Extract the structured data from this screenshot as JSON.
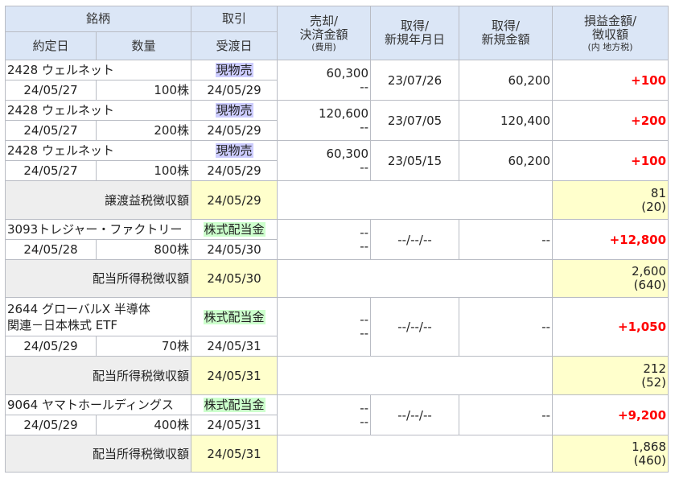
{
  "header": {
    "row1": [
      "銘柄",
      "取引",
      "売却/\n決済金額",
      "取得/\n新規年月日",
      "取得/\n新規金額",
      "損益金額/\n徴収額"
    ],
    "row2": [
      "約定日",
      "数量",
      "受渡日"
    ],
    "sell_sub": "(費用)",
    "pl_sub": "(内 地方税)"
  },
  "trades": [
    {
      "name": "2428 ウェルネット",
      "type": "現物売",
      "tdate": "24/05/27",
      "qty": "100株",
      "ddate": "24/05/29",
      "amount": "60,300",
      "cost": "--",
      "acq_date": "23/07/26",
      "acq_amount": "60,200",
      "pl": "+100"
    },
    {
      "name": "2428 ウェルネット",
      "type": "現物売",
      "tdate": "24/05/27",
      "qty": "200株",
      "ddate": "24/05/29",
      "amount": "120,600",
      "cost": "--",
      "acq_date": "23/07/05",
      "acq_amount": "120,400",
      "pl": "+200"
    },
    {
      "name": "2428 ウェルネット",
      "type": "現物売",
      "tdate": "24/05/27",
      "qty": "100株",
      "ddate": "24/05/29",
      "amount": "60,300",
      "cost": "--",
      "acq_date": "23/05/15",
      "acq_amount": "60,200",
      "pl": "+100"
    }
  ],
  "tax1": {
    "label": "譲渡益税徴収額",
    "date": "24/05/29",
    "amount": "81",
    "local": "(20)"
  },
  "div1": {
    "name": "3093トレジャー・ファクトリー",
    "type": "株式配当金",
    "tdate": "24/05/28",
    "qty": "800株",
    "ddate": "24/05/30",
    "amount": "--",
    "cost": "--",
    "acq_date": "--/--/--",
    "acq_amount": "--",
    "pl": "+12,800"
  },
  "tax2": {
    "label": "配当所得税徴収額",
    "date": "24/05/30",
    "amount": "2,600",
    "local": "(640)"
  },
  "div2": {
    "name1": "2644 グローバルX 半導体",
    "name2": "関連－日本株式 ETF",
    "type": "株式配当金",
    "tdate": "24/05/29",
    "qty": "70株",
    "ddate": "24/05/31",
    "amount": "--",
    "cost": "--",
    "acq_date": "--/--/--",
    "acq_amount": "--",
    "pl": "+1,050"
  },
  "tax3": {
    "label": "配当所得税徴収額",
    "date": "24/05/31",
    "amount": "212",
    "local": "(52)"
  },
  "div3": {
    "name": "9064 ヤマトホールディングス",
    "type": "株式配当金",
    "tdate": "24/05/29",
    "qty": "400株",
    "ddate": "24/05/31",
    "amount": "--",
    "cost": "--",
    "acq_date": "--/--/--",
    "acq_amount": "--",
    "pl": "+9,200"
  },
  "tax4": {
    "label": "配当所得税徴収額",
    "date": "24/05/31",
    "amount": "1,868",
    "local": "(460)"
  }
}
